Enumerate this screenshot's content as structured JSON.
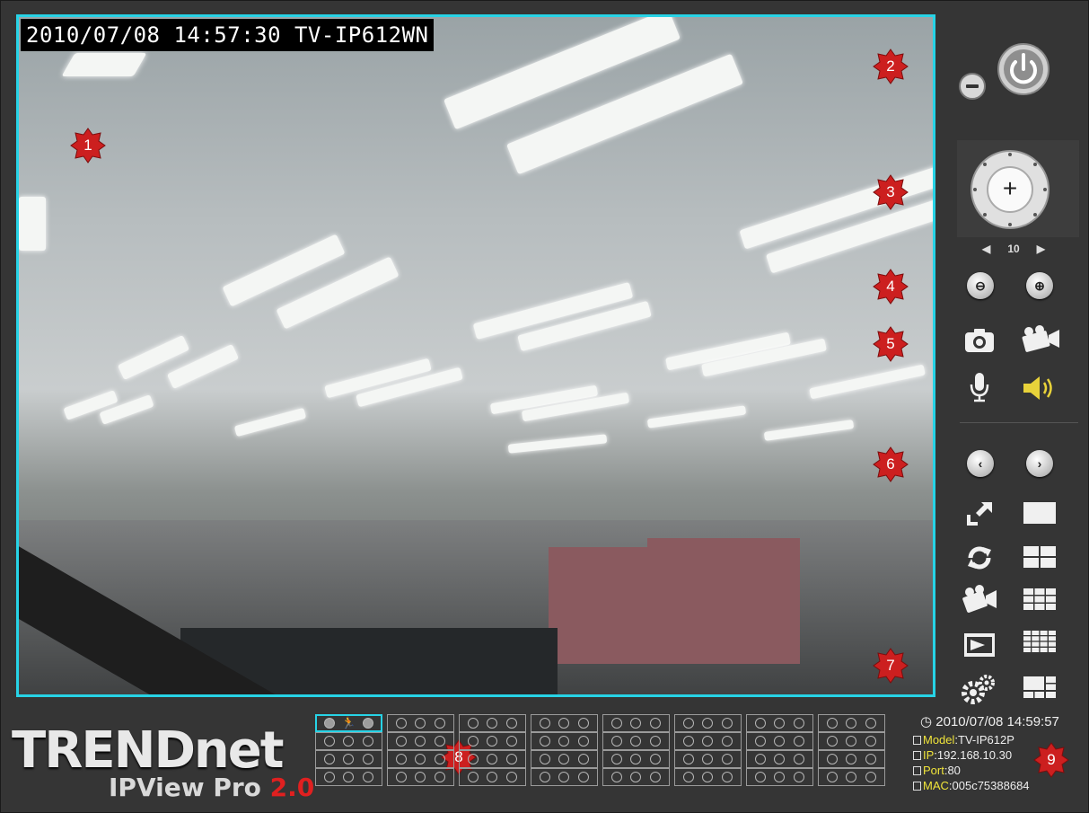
{
  "osd": {
    "text": "2010/07/08  14:57:30 TV-IP612WN"
  },
  "markers": [
    "1",
    "2",
    "3",
    "4",
    "5",
    "6",
    "7",
    "8",
    "9"
  ],
  "ptz": {
    "speed_value": "10",
    "home_label": "+"
  },
  "branding": {
    "logo": "TRENDnet",
    "product": "IPView Pro",
    "version": "2.0"
  },
  "status": {
    "datetime": "2010/07/08 14:59:57",
    "model_label": "Model",
    "model_value": ":TV-IP612P",
    "ip_label": "IP",
    "ip_value": ":192.168.10.30",
    "port_label": "Port",
    "port_value": ":80",
    "mac_label": "MAC",
    "mac_value": ":005c75388684"
  },
  "channels": {
    "columns": 8,
    "rows": 4,
    "active": 0
  },
  "colors": {
    "accent": "#27d3e6",
    "marker": "#cc1f1f",
    "speaker": "#e8d23a",
    "version": "#e02020"
  },
  "icons": [
    "standby-icon",
    "power-icon",
    "ptz-joystick-icon",
    "zoom-out-icon",
    "zoom-in-icon",
    "snapshot-icon",
    "record-icon",
    "microphone-icon",
    "speaker-icon",
    "prev-icon",
    "next-icon",
    "fullscreen-icon",
    "layout-1-icon",
    "refresh-icon",
    "layout-4-icon",
    "playback-icon",
    "layout-9-icon",
    "video-player-icon",
    "layout-16-icon",
    "settings-icon",
    "layout-custom-icon",
    "clock-icon",
    "motion-icon"
  ]
}
